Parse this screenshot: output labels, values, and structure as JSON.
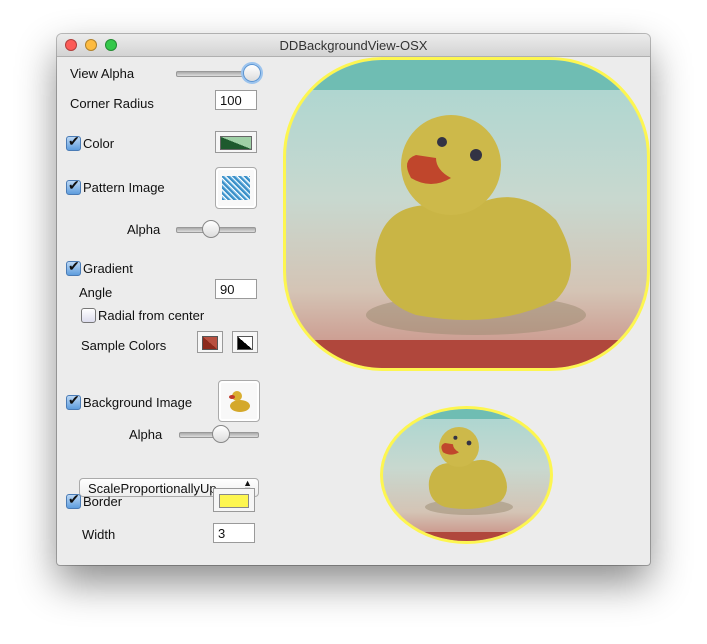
{
  "window": {
    "title": "DDBackgroundView-OSX"
  },
  "controls": {
    "view_alpha": {
      "label": "View Alpha",
      "value": 1.0
    },
    "corner_radius": {
      "label": "Corner Radius",
      "value": "100"
    },
    "color": {
      "label": "Color",
      "checked": true,
      "swatch_dark": "#1e5a2e",
      "swatch_light": "#9fd0a6"
    },
    "pattern_image": {
      "label": "Pattern Image",
      "checked": true
    },
    "pattern_alpha": {
      "label": "Alpha",
      "value": 0.4
    },
    "gradient": {
      "label": "Gradient",
      "checked": true
    },
    "angle": {
      "label": "Angle",
      "value": "90"
    },
    "radial": {
      "label": "Radial from center",
      "checked": false
    },
    "sample_colors": {
      "label": "Sample Colors",
      "color1": "#8c2a1c",
      "color2": "#000000"
    },
    "background_image": {
      "label": "Background Image",
      "checked": true
    },
    "bg_alpha": {
      "label": "Alpha",
      "value": 0.5
    },
    "scaling": {
      "value": "ScaleProportionallyUp…"
    },
    "border": {
      "label": "Border",
      "checked": true,
      "color": "#fdf650"
    },
    "border_width": {
      "label": "Width",
      "value": "3"
    }
  }
}
